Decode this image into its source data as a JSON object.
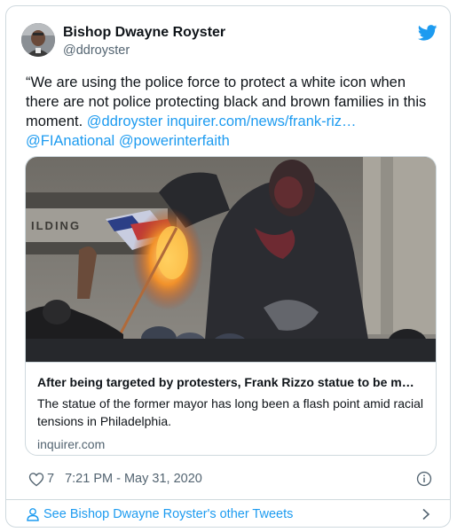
{
  "author": {
    "display_name": "Bishop Dwayne Royster",
    "handle": "@ddroyster",
    "avatar_icon": "profile-photo"
  },
  "tweet": {
    "text_lead": "“We are using the police force to protect a white icon when there are not police protecting black and brown families in this moment. ",
    "mention_1": "@ddroyster",
    "link": "inquirer.com/news/frank-riz…",
    "mention_2": "@FIAnational",
    "mention_3": "@powerinterfaith"
  },
  "card": {
    "image_sign_text": "ILDING",
    "title": "After being targeted by protesters, Frank Rizzo statue to be m…",
    "description": "The statue of the former mayor has long been a flash point amid racial tensions in Philadelphia.",
    "domain": "inquirer.com"
  },
  "meta": {
    "likes": "7",
    "timestamp": "7:21 PM - May 31, 2020"
  },
  "footer": {
    "label": "See Bishop Dwayne Royster's other Tweets"
  },
  "colors": {
    "link": "#1d9bf0",
    "secondary_text": "#536471",
    "border": "#cfd9de"
  }
}
